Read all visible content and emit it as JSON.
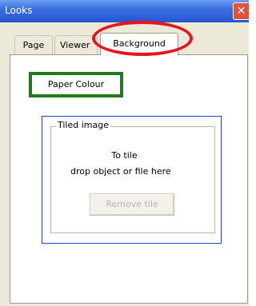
{
  "window": {
    "title": "Looks",
    "close_symbol": "✕"
  },
  "tabs": [
    {
      "label": "Page",
      "selected": false
    },
    {
      "label": "Viewer",
      "selected": false
    },
    {
      "label": "Background",
      "selected": true
    }
  ],
  "background": {
    "paper_colour_label": "Paper Colour",
    "tiled_group": {
      "legend": "Tiled image",
      "line1": "To tile",
      "line2": "drop object or file here",
      "remove_tile_label": "Remove tile",
      "remove_tile_enabled": false
    }
  },
  "annotation_colors": {
    "tab_highlight": "#e8141c",
    "button_highlight": "#1f7a1f",
    "frame_highlight": "#2a3fd6"
  }
}
